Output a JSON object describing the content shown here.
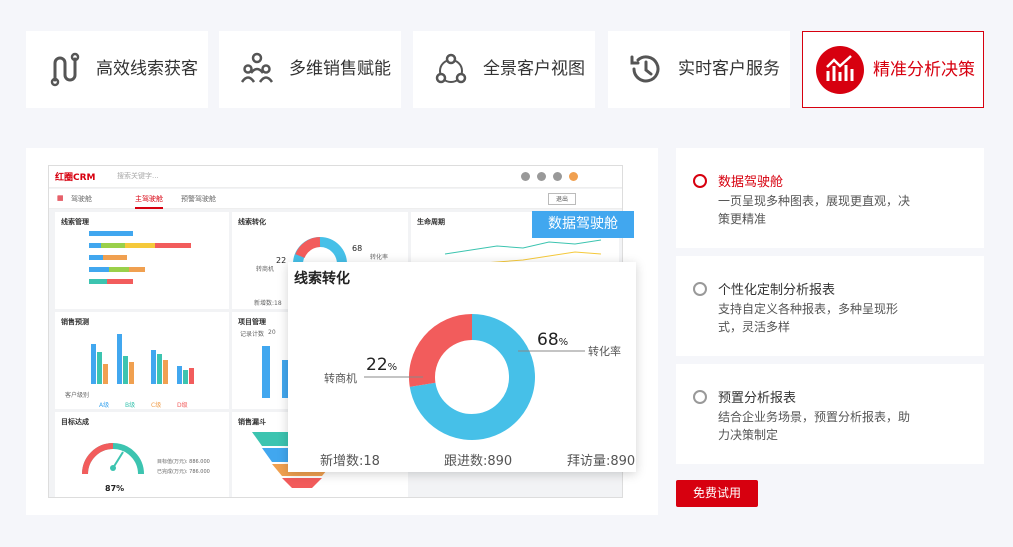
{
  "tabs": [
    {
      "label": "高效线索获客",
      "icon": "route-icon"
    },
    {
      "label": "多维销售赋能",
      "icon": "team-icon"
    },
    {
      "label": "全景客户视图",
      "icon": "network-icon"
    },
    {
      "label": "实时客户服务",
      "icon": "history-icon"
    },
    {
      "label": "精准分析决策",
      "icon": "chart-trend-icon",
      "active": true
    }
  ],
  "preview": {
    "badge": "数据驾驶舱",
    "brand": "红圈CRM",
    "search_placeholder": "搜索关键字...",
    "nav_title": "驾驶舱",
    "nav_tabs": [
      "主驾驶舱",
      "预警驾驶舱"
    ],
    "exit_label": "退出",
    "cards": {
      "leads": "线索管理",
      "conversion": "线索转化",
      "lifecycle": "生命周期",
      "forecast": "销售预测",
      "project": "项目管理",
      "target": "目标达成",
      "funnel": "销售漏斗"
    },
    "mini": {
      "conv_pct": "68",
      "conv_pct2": "22",
      "conv_label": "转化率",
      "lead_label": "转商机",
      "new_label": "新增数:18",
      "forecast_axis": "客户级别",
      "legend": [
        "A级",
        "B级",
        "C级",
        "D级"
      ],
      "project_count_label": "记录计数",
      "project_count": "20",
      "gauge_pct": "87%",
      "gauge_target": "目标值(万元): 886.000",
      "gauge_done": "已完成(万元): 786.000"
    },
    "zoom": {
      "title": "线索转化",
      "pct_big": "68",
      "pct_big_label": "转化率",
      "pct_small": "22",
      "pct_small_label": "转商机",
      "pct_unit": "%",
      "footer": [
        "新增数:18",
        "跟进数:890",
        "拜访量:890"
      ]
    }
  },
  "features": [
    {
      "title": "数据驾驶舱",
      "desc": "一页呈现多种图表，展现更直观，决策更精准",
      "active": true
    },
    {
      "title": "个性化定制分析报表",
      "desc": "支持自定义各种报表，多种呈现形式，灵活多样"
    },
    {
      "title": "预置分析报表",
      "desc": "结合企业务场景，预置分析报表，助力决策制定"
    }
  ],
  "trial_button": "免费试用",
  "colors": {
    "accent": "#d7000f",
    "blue": "#41a7ef",
    "ring_blue": "#46c0e8",
    "ring_red": "#f25c5c"
  },
  "chart_data": {
    "type": "pie",
    "title": "线索转化",
    "slices": [
      {
        "label": "转化率",
        "value": 68
      },
      {
        "label": "转商机",
        "value": 22
      }
    ]
  }
}
